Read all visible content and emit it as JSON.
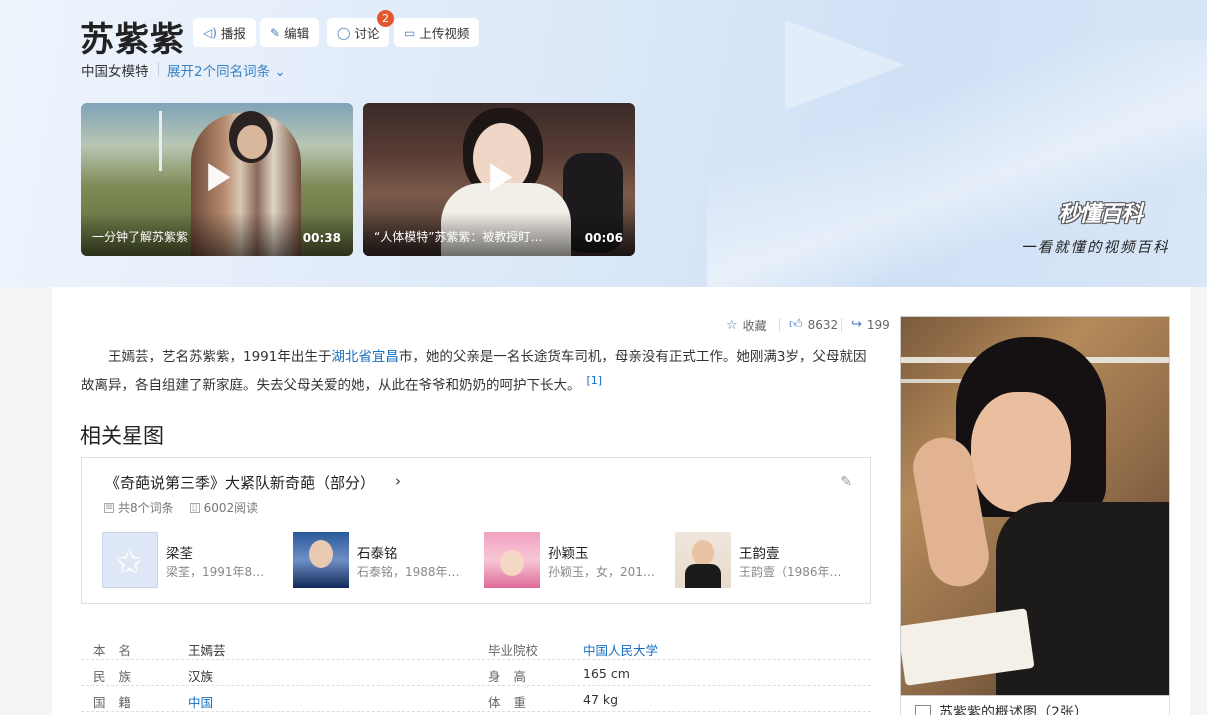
{
  "header": {
    "title": "苏紫紫",
    "actions": {
      "broadcast": "播报",
      "edit": "编辑",
      "discuss": "讨论",
      "discuss_badge": "2",
      "upload_video": "上传视频"
    },
    "subtitle": "中国女模特",
    "expand_label": "展开2个同名词条",
    "videos": [
      {
        "title": "一分钟了解苏紫紫",
        "duration": "00:38"
      },
      {
        "title": "“人体模特”苏紫紫：被教授盯着不放…",
        "duration": "00:06"
      }
    ],
    "brand": "秒懂百科",
    "slogan": "一看就懂的视频百科"
  },
  "meta": {
    "favorite": "收藏",
    "likes": "8632",
    "shares": "199"
  },
  "intro": {
    "before_link": "王嫣芸，艺名苏紫紫，1991年出生于",
    "link": "湖北省宜昌",
    "after_link": "市，她的父亲是一名长途货车司机，母亲没有正式工作。她刚满3岁，父母就因故离异，各自组建了新家庭。失去父母关爱的她，从此在爷爷和奶奶的呵护下长大。",
    "ref": "[1]"
  },
  "star_map": {
    "section_title": "相关星图",
    "title": "《奇葩说第三季》大紧队新奇葩（部分）",
    "entries": "共8个词条",
    "reads": "6002阅读",
    "people": [
      {
        "name": "梁荃",
        "desc": "梁荃，1991年8月…"
      },
      {
        "name": "石泰铭",
        "desc": "石泰铭，1988年8…"
      },
      {
        "name": "孙颖玉",
        "desc": "孙颖玉，女，2016…"
      },
      {
        "name": "王韵壹",
        "desc": "王韵壹（1986年6…"
      }
    ]
  },
  "info": [
    {
      "k1": "本名",
      "v1": "王嫣芸",
      "k2": "毕业院校",
      "v2": "中国人民大学"
    },
    {
      "k1": "民族",
      "v1": "汉族",
      "k2": "身高",
      "v2": "165 cm"
    },
    {
      "k1": "国籍",
      "v1": "中国",
      "k2": "体重",
      "v2": "47 kg"
    }
  ],
  "side": {
    "caption": "苏紫紫的概述图（2张）"
  },
  "colors": {
    "link": "#136ec2",
    "accent_icon": "#4c7dc2",
    "badge": "#e4572e"
  }
}
